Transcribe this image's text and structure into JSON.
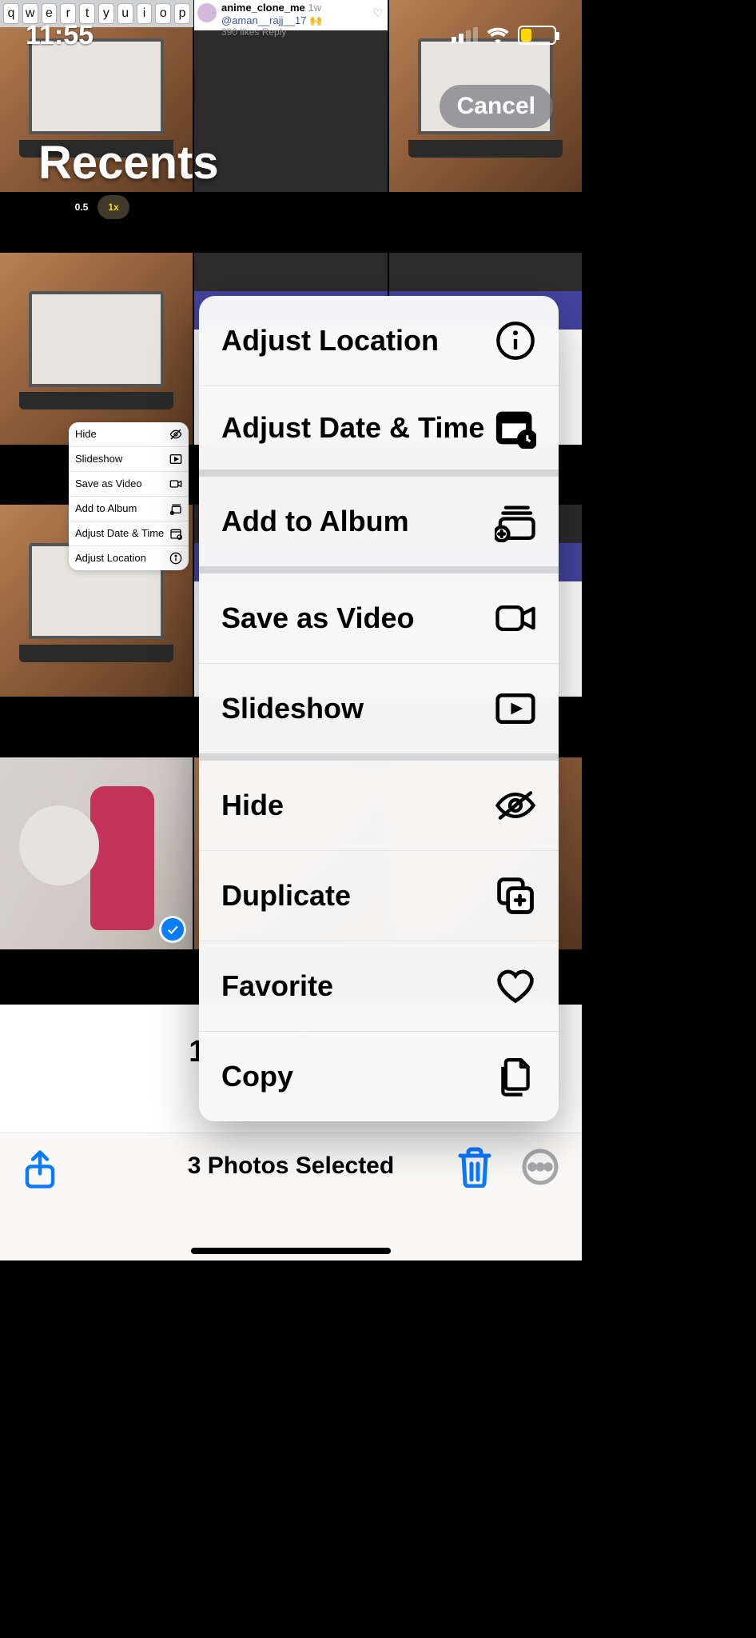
{
  "status": {
    "time": "11:55"
  },
  "keyboard_row": [
    "q",
    "w",
    "e",
    "r",
    "t",
    "y",
    "u",
    "i",
    "o",
    "p"
  ],
  "social": {
    "user": "anime_clone_me",
    "age": "1w",
    "mention": "@aman__rajj__17 🙌",
    "likes_line": "390 likes   Reply"
  },
  "album_title": "Recents",
  "zoom": {
    "a": "0.5",
    "b": "1x"
  },
  "cancel": "Cancel",
  "mini_menu": [
    {
      "label": "Hide",
      "icon": "hide-icon"
    },
    {
      "label": "Slideshow",
      "icon": "play-icon"
    },
    {
      "label": "Save as Video",
      "icon": "video-icon"
    },
    {
      "label": "Add to Album",
      "icon": "album-icon"
    },
    {
      "label": "Adjust Date & Time",
      "icon": "calendar-icon"
    },
    {
      "label": "Adjust Location",
      "icon": "info-icon"
    }
  ],
  "footer": {
    "count_line": "18,372 Photos",
    "sync_line": "Syncing"
  },
  "toolbar_center": "3 Photos Selected",
  "menu": [
    {
      "group": 0,
      "label": "Adjust Location",
      "icon": "info-icon"
    },
    {
      "group": 0,
      "label": "Adjust Date & Time",
      "icon": "calendar-icon"
    },
    {
      "group": 1,
      "label": "Add to Album",
      "icon": "album-icon"
    },
    {
      "group": 2,
      "label": "Save as Video",
      "icon": "video-icon"
    },
    {
      "group": 2,
      "label": "Slideshow",
      "icon": "play-icon"
    },
    {
      "group": 3,
      "label": "Hide",
      "icon": "hide-icon"
    },
    {
      "group": 3,
      "label": "Duplicate",
      "icon": "duplicate-icon"
    },
    {
      "group": 3,
      "label": "Favorite",
      "icon": "heart-icon"
    },
    {
      "group": 3,
      "label": "Copy",
      "icon": "copy-icon"
    }
  ],
  "colors": {
    "accent": "#0a7aff",
    "check": "#0a84ff",
    "battery": "#ffd60a"
  }
}
